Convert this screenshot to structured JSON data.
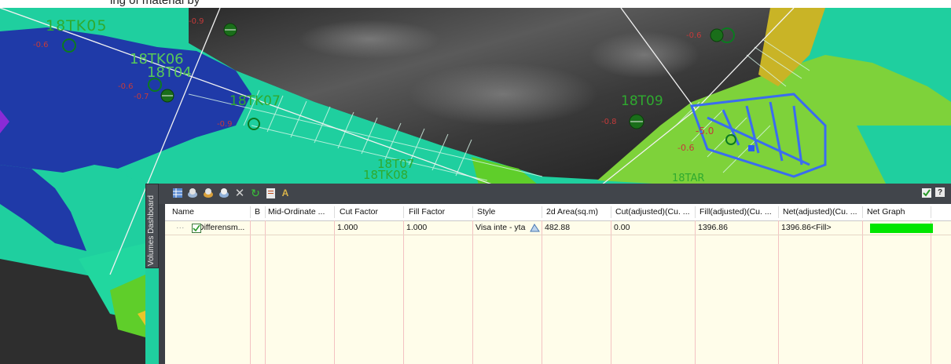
{
  "header_fragment": "ing of material by",
  "map": {
    "labels": [
      {
        "text": "18TK05",
        "color": "#2faa2f"
      },
      {
        "text": "18TK06",
        "color": "#58c958"
      },
      {
        "text": "18T04",
        "color": "#58c958"
      },
      {
        "text": "18TK07",
        "color": "#2faa2f"
      },
      {
        "text": "18T09",
        "color": "#2faa2f"
      },
      {
        "text": "18T07",
        "color": "#2faa2f"
      },
      {
        "text": "18TK08",
        "color": "#2faa2f"
      },
      {
        "text": "-0.9",
        "color": "#c43a3a"
      },
      {
        "text": "-0.6",
        "color": "#c43a3a"
      },
      {
        "text": "-0.6",
        "color": "#c43a3a"
      },
      {
        "text": "-0.7",
        "color": "#c43a3a"
      },
      {
        "text": "-0.8",
        "color": "#c43a3a"
      },
      {
        "text": "-0.6",
        "color": "#c43a3a"
      },
      {
        "text": "-0.9",
        "color": "#c43a3a"
      },
      {
        "text": "-5.0",
        "color": "#c43a3a"
      },
      {
        "text": "-0.6",
        "color": "#c43a3a"
      },
      {
        "text": "18TAR",
        "color": "#2faa2f"
      }
    ]
  },
  "dashboard": {
    "tab_label": "Volumes Dashboard",
    "toolbar": {
      "icons": [
        "grid-icon",
        "add-surface-icon",
        "add-volume-icon",
        "add-boundary-icon",
        "remove-icon",
        "refresh-icon",
        "report-icon",
        "label-icon"
      ],
      "check_icon": "check-icon",
      "help_icon": "help-icon",
      "help_label": "?"
    },
    "columns": [
      "Name",
      "B",
      "Mid-Ordinate ...",
      "Cut Factor",
      "Fill Factor",
      "Style",
      "2d Area(sq.m)",
      "Cut(adjusted)(Cu. ...",
      "Fill(adjusted)(Cu. ...",
      "Net(adjusted)(Cu. ...",
      "Net Graph"
    ],
    "row": {
      "name": "Differensm...",
      "checked": true,
      "b": "",
      "mid_ordinate": "",
      "cut_factor": "1.000",
      "fill_factor": "1.000",
      "style": "Visa inte - yta",
      "area": "482.88",
      "cut": "0.00",
      "fill": "1396.86",
      "net": "1396.86<Fill>",
      "net_graph_color": "#00e600"
    }
  },
  "colors": {
    "deep_blue": "#1f3aa8",
    "teal": "#1fd3a0",
    "light_green": "#8be04a",
    "dark_terrain": "#3e3e3e",
    "yellow": "#c9b426",
    "panel_bg": "#3b3f45",
    "grid_bg": "#fffdea"
  }
}
